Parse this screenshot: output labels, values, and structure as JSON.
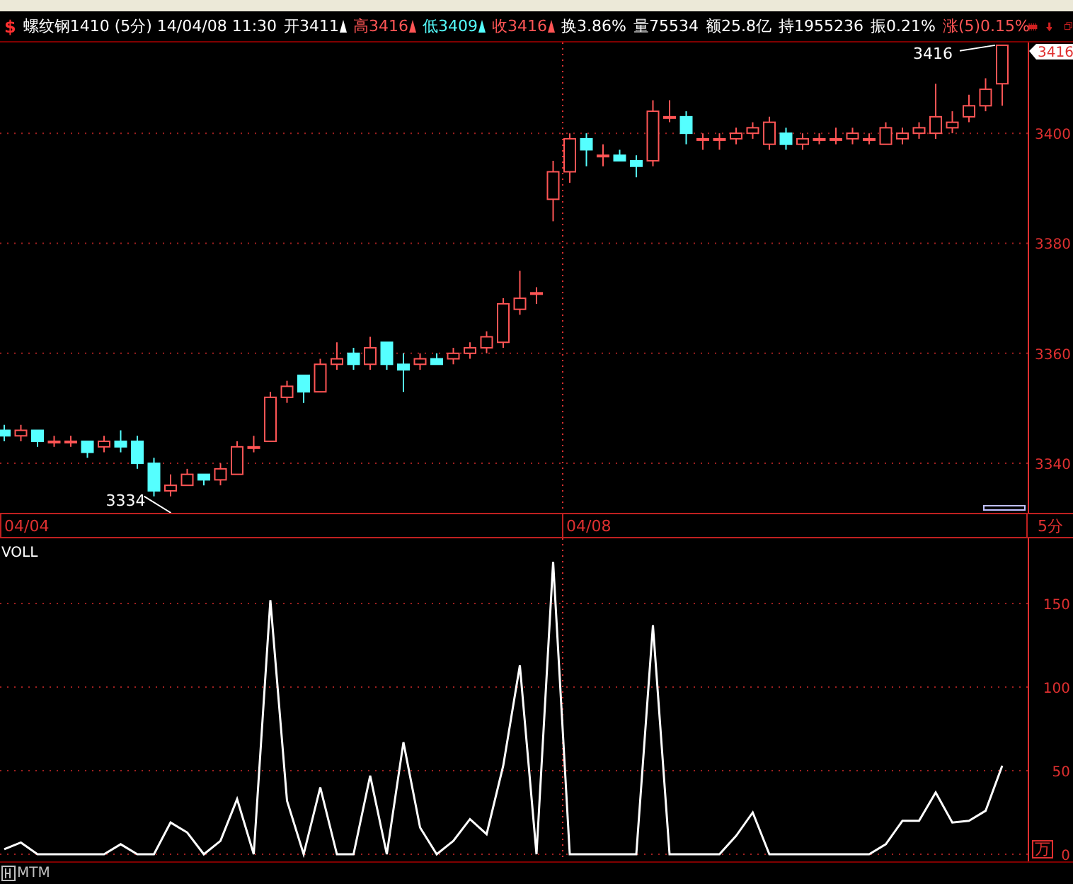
{
  "header": {
    "symbol": "$",
    "title": "螺纹钢1410 (5分) 14/04/08 11:30",
    "stats": [
      {
        "text": "开3411",
        "color": "#ffffff",
        "arrow": true
      },
      {
        "text": "高3416",
        "color": "#ff5555",
        "arrow": true
      },
      {
        "text": "低3409",
        "color": "#55ffff",
        "arrow": true
      },
      {
        "text": "收3416",
        "color": "#ff5555",
        "arrow": true
      },
      {
        "text": "换3.86%",
        "color": "#ffffff",
        "arrow": false
      },
      {
        "text": "量75534",
        "color": "#ffffff",
        "arrow": false
      },
      {
        "text": "额25.8亿",
        "color": "#ffffff",
        "arrow": false
      },
      {
        "text": "持1955236",
        "color": "#ffffff",
        "arrow": false
      },
      {
        "text": "振0.21%",
        "color": "#ffffff",
        "arrow": false
      },
      {
        "text": "涨(5)0.15%",
        "color": "#ff5555",
        "arrow": false
      }
    ]
  },
  "price_panel": {
    "price_tag": "3416",
    "high_label": "3416",
    "low_label": "3334",
    "chart_data": {
      "type": "candlestick",
      "ylim": [
        3331,
        3416.5
      ],
      "yticks": [
        {
          "value": 3400,
          "label": "3400"
        },
        {
          "value": 3380,
          "label": "3380"
        },
        {
          "value": 3360,
          "label": "3360"
        },
        {
          "value": 3340,
          "label": "3340"
        }
      ],
      "grid": true,
      "ohlc": [
        [
          3346,
          3347,
          3344,
          3345
        ],
        [
          3345,
          3347,
          3344,
          3346
        ],
        [
          3346,
          3346,
          3343,
          3344
        ],
        [
          3344,
          3345,
          3343,
          3344
        ],
        [
          3344,
          3345,
          3343,
          3344
        ],
        [
          3344,
          3344,
          3341,
          3342
        ],
        [
          3343,
          3345,
          3342,
          3344
        ],
        [
          3344,
          3346,
          3342,
          3343
        ],
        [
          3344,
          3345,
          3339,
          3340
        ],
        [
          3340,
          3341,
          3334,
          3335
        ],
        [
          3335,
          3338,
          3334,
          3336
        ],
        [
          3336,
          3339,
          3336,
          3338
        ],
        [
          3338,
          3338,
          3336,
          3337
        ],
        [
          3337,
          3340,
          3336,
          3339
        ],
        [
          3338,
          3344,
          3338,
          3343
        ],
        [
          3343,
          3345,
          3342,
          3343
        ],
        [
          3344,
          3353,
          3344,
          3352
        ],
        [
          3352,
          3355,
          3351,
          3354
        ],
        [
          3356,
          3356,
          3351,
          3353
        ],
        [
          3353,
          3359,
          3353,
          3358
        ],
        [
          3358,
          3362,
          3357,
          3359
        ],
        [
          3360,
          3361,
          3357,
          3358
        ],
        [
          3358,
          3363,
          3357,
          3361
        ],
        [
          3362,
          3362,
          3357,
          3358
        ],
        [
          3358,
          3360,
          3353,
          3357
        ],
        [
          3358,
          3360,
          3357,
          3359
        ],
        [
          3359,
          3360,
          3358,
          3358
        ],
        [
          3359,
          3361,
          3358,
          3360
        ],
        [
          3360,
          3362,
          3359,
          3361
        ],
        [
          3361,
          3364,
          3360,
          3363
        ],
        [
          3362,
          3370,
          3361,
          3369
        ],
        [
          3368,
          3375,
          3367,
          3370
        ],
        [
          3371,
          3372,
          3369,
          3371
        ],
        [
          3388,
          3395,
          3384,
          3393
        ],
        [
          3393,
          3400,
          3391,
          3399
        ],
        [
          3399,
          3400,
          3394,
          3397
        ],
        [
          3396,
          3398,
          3394,
          3396
        ],
        [
          3396,
          3397,
          3395,
          3395
        ],
        [
          3395,
          3396,
          3392,
          3394
        ],
        [
          3395,
          3406,
          3394,
          3404
        ],
        [
          3403,
          3406,
          3402,
          3403
        ],
        [
          3403,
          3404,
          3398,
          3400
        ],
        [
          3399,
          3400,
          3397,
          3399
        ],
        [
          3399,
          3400,
          3397,
          3399
        ],
        [
          3399,
          3401,
          3398,
          3400
        ],
        [
          3400,
          3402,
          3399,
          3401
        ],
        [
          3398,
          3403,
          3397,
          3402
        ],
        [
          3400,
          3401,
          3397,
          3398
        ],
        [
          3398,
          3400,
          3397,
          3399
        ],
        [
          3399,
          3400,
          3398,
          3399
        ],
        [
          3399,
          3401,
          3398,
          3399
        ],
        [
          3399,
          3401,
          3398,
          3400
        ],
        [
          3399,
          3400,
          3398,
          3399
        ],
        [
          3398,
          3402,
          3398,
          3401
        ],
        [
          3399,
          3401,
          3398,
          3400
        ],
        [
          3400,
          3402,
          3399,
          3401
        ],
        [
          3400,
          3409,
          3399,
          3403
        ],
        [
          3401,
          3404,
          3400,
          3402
        ],
        [
          3403,
          3407,
          3402,
          3405
        ],
        [
          3405,
          3410,
          3404,
          3408
        ],
        [
          3409,
          3416,
          3405,
          3416
        ]
      ]
    }
  },
  "date_row": {
    "dates": [
      "04/04",
      "04/08"
    ],
    "period": "5分"
  },
  "volume_panel": {
    "unit": "万",
    "chart_data": {
      "type": "line",
      "ylim": [
        0,
        189
      ],
      "yticks": [
        0,
        50,
        100,
        150
      ],
      "grid": true,
      "series": [
        {
          "name": "VOLL",
          "color": "#ffffff",
          "values": [
            3,
            7,
            0,
            0,
            0,
            0,
            0,
            6,
            0,
            0,
            19,
            13,
            0,
            8,
            33,
            0,
            152,
            32,
            0,
            40,
            0,
            0,
            47,
            0,
            67,
            16,
            0,
            8,
            21,
            12,
            53,
            113,
            0,
            175,
            0,
            0,
            0,
            0,
            0,
            137,
            0,
            0,
            0,
            0,
            11,
            25,
            0,
            0,
            0,
            0,
            0,
            0,
            0,
            6,
            20,
            20,
            37,
            19,
            20,
            26,
            53
          ]
        }
      ]
    }
  },
  "bottom_bar": {
    "indicator_tab": "MTM"
  }
}
